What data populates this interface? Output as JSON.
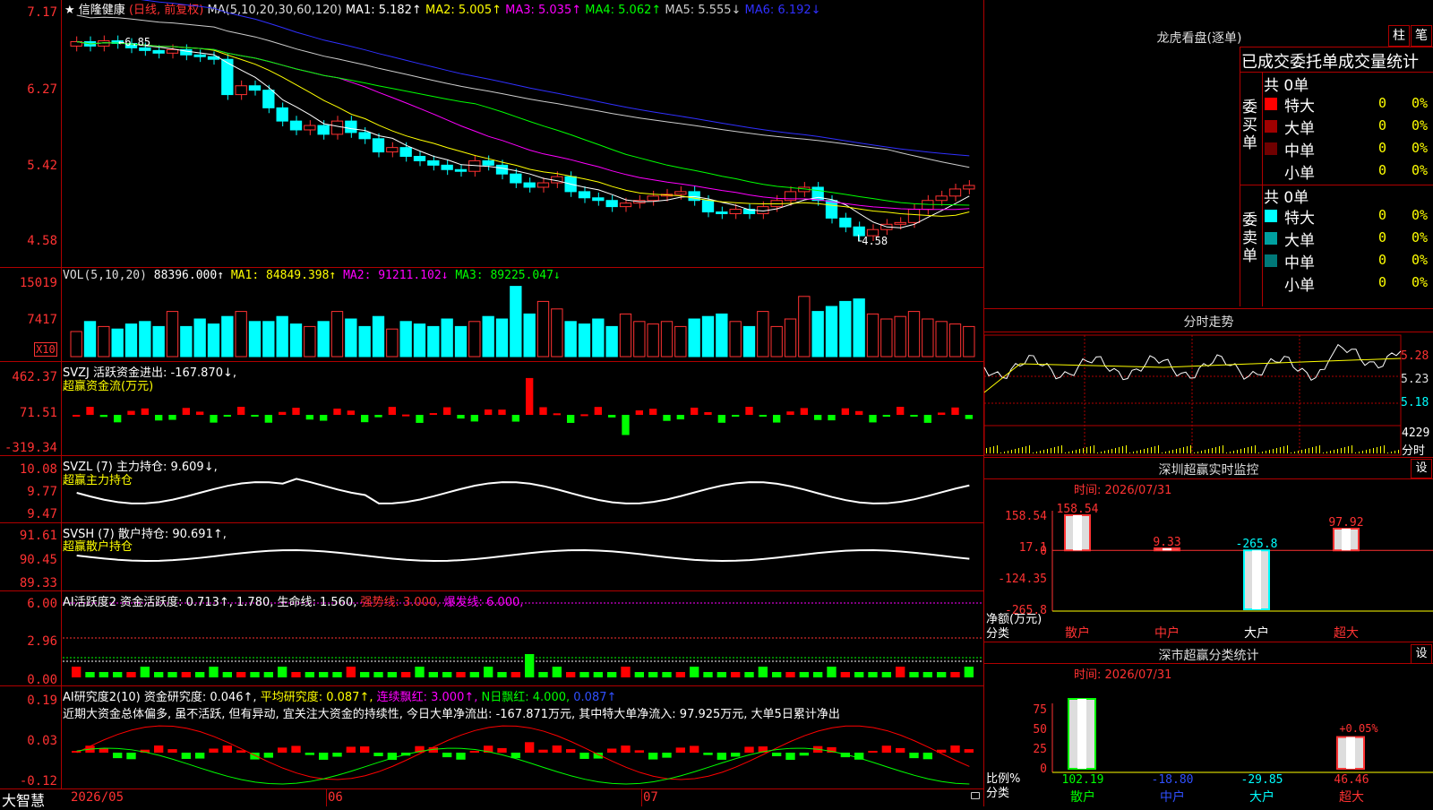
{
  "stock": {
    "star": "★",
    "name": "信隆健康",
    "mode": "(日线, 前复权)"
  },
  "ma": {
    "label": "MA(5,10,20,30,60,120)",
    "items": [
      {
        "label": "MA1: 5.182↑",
        "color": "#ffffff"
      },
      {
        "label": "MA2: 5.005↑",
        "color": "#ffff00"
      },
      {
        "label": "MA3: 5.035↑",
        "color": "#ff00ff"
      },
      {
        "label": "MA4: 5.062↑",
        "color": "#00ff00"
      },
      {
        "label": "MA5: 5.555↓",
        "color": "#cccccc"
      },
      {
        "label": "MA6: 6.192↓",
        "color": "#3030ff"
      }
    ]
  },
  "price_axis": [
    "7.17",
    "6.27",
    "5.42",
    "4.58"
  ],
  "annotations": {
    "high": "6.85",
    "low": "4.58"
  },
  "vol": {
    "label": "VOL(5,10,20)",
    "value": "88396.000↑",
    "items": [
      {
        "label": "MA1: 84849.398↑",
        "color": "#ffff00"
      },
      {
        "label": "MA2: 91211.102↓",
        "color": "#ff00ff"
      },
      {
        "label": "MA3: 89225.047↓",
        "color": "#00ff00"
      }
    ],
    "axis": [
      "15019",
      "7417"
    ],
    "unit": "X10"
  },
  "svzj": {
    "label": "SVZJ  活跃资金进出: -167.870↓,",
    "sub": "超赢资金流(万元)",
    "axis": [
      "462.37",
      "71.51",
      "-319.34"
    ]
  },
  "svzl": {
    "label": "SVZL (7) 主力持仓: 9.609↓,",
    "sub": "超赢主力持仓",
    "axis": [
      "10.08",
      "9.77",
      "9.47"
    ]
  },
  "svsh": {
    "label": "SVSH (7) 散户持仓: 90.691↑,",
    "sub": "超赢散户持仓",
    "axis": [
      "91.61",
      "90.45",
      "89.33"
    ]
  },
  "ai1": {
    "a": "AI活跃度2 资金活跃度: 0.713↑, 1.780, 生命线: 1.560,",
    "b": "强势线: 3.000,",
    "c": "爆发线: 6.000,",
    "axis": [
      "6.00",
      "2.96",
      "0.00"
    ]
  },
  "ai2": {
    "a": "AI研究度2(10) 资金研究度: 0.046↑,",
    "b": "平均研究度: 0.087↑,",
    "c": "连续飘红: 3.000↑,",
    "d": "N日飘红: 4.000,",
    "e": "0.087↑",
    "comment": "近期大资金总体偏多, 虽不活跃, 但有异动, 宜关注大资金的持续性, 今日大单净流出: -167.871万元, 其中特大单净流入: 97.925万元, 大单5日累计净出",
    "axis": [
      "0.19",
      "0.03",
      "-0.12"
    ]
  },
  "bottom": {
    "brand": "大智慧",
    "dates": [
      "2026/05",
      "06",
      "07"
    ]
  },
  "longhu": {
    "title": "龙虎看盘(逐单)",
    "btn1": "柱",
    "btn2": "笔",
    "header": "已成交委托单成交量统计",
    "buy": {
      "side": "委买单",
      "total": "共 0单",
      "rows": [
        {
          "label": "特大",
          "value": "0",
          "pct": "0%",
          "color": "#ff0000"
        },
        {
          "label": "大单",
          "value": "0",
          "pct": "0%",
          "color": "#a00000"
        },
        {
          "label": "中单",
          "value": "0",
          "pct": "0%",
          "color": "#700000"
        },
        {
          "label": "小单",
          "value": "0",
          "pct": "0%",
          "color": "#000000"
        }
      ]
    },
    "sell": {
      "side": "委卖单",
      "total": "共 0单",
      "rows": [
        {
          "label": "特大",
          "value": "0",
          "pct": "0%",
          "color": "#00ffff"
        },
        {
          "label": "大单",
          "value": "0",
          "pct": "0%",
          "color": "#00a0a0"
        },
        {
          "label": "中单",
          "value": "0",
          "pct": "0%",
          "color": "#007878"
        },
        {
          "label": "小单",
          "value": "0",
          "pct": "0%",
          "color": "#000000"
        }
      ]
    }
  },
  "fenshi": {
    "title": "分时走势",
    "axis": [
      "5.28",
      "5.23",
      "5.18"
    ],
    "vol": "4229",
    "vol_label": "分时"
  },
  "monitor": {
    "title": "深圳超赢实时监控",
    "set": "设",
    "time": "时间: 2026/07/31",
    "axis": [
      "158.54",
      "17.1",
      "0",
      "-124.35",
      "-265.8"
    ],
    "ylabel": "净额(万元)",
    "xlabel": "分类",
    "cats": [
      "散户",
      "中户",
      "大户",
      "超大"
    ],
    "values": [
      158.54,
      9.33,
      -265.8,
      97.92
    ],
    "value_labels": [
      "158.54",
      "9.33",
      "-265.8",
      "97.92"
    ]
  },
  "stats": {
    "title": "深市超赢分类统计",
    "set": "设",
    "time": "时间: 2026/07/31",
    "axis": [
      "75",
      "50",
      "25",
      "0"
    ],
    "ylabel": "比例%",
    "xlabel": "分类",
    "cats": [
      "散户",
      "中户",
      "大户",
      "超大"
    ],
    "values": [
      102.19,
      -18.8,
      -29.85,
      46.46
    ],
    "value_labels": [
      "102.19",
      "-18.80",
      "-29.85",
      "46.46"
    ],
    "note": "+0.05%"
  }
}
